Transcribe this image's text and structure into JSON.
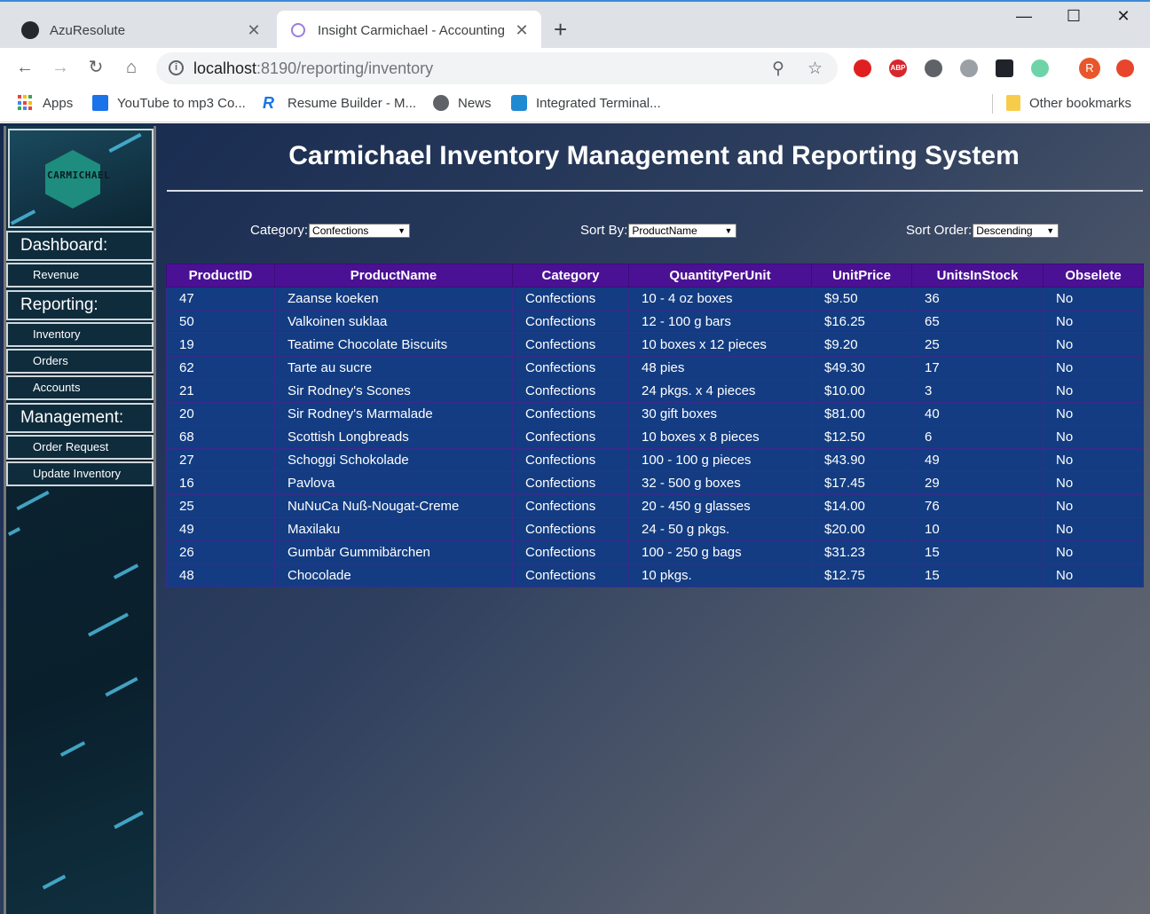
{
  "browser": {
    "tabs": [
      {
        "title": "AzuResolute",
        "icon": "github-icon"
      },
      {
        "title": "Insight Carmichael - Accounting",
        "icon": "app-favicon"
      }
    ],
    "url_host": "localhost",
    "url_path": ":8190/reporting/inventory",
    "bookmarks": [
      {
        "label": "Apps",
        "icon": "apps-icon"
      },
      {
        "label": "YouTube to mp3 Co...",
        "icon": "ytmp3-icon"
      },
      {
        "label": "Resume Builder - M...",
        "icon": "resume-r-icon"
      },
      {
        "label": "News",
        "icon": "globe-icon"
      },
      {
        "label": "Integrated Terminal...",
        "icon": "vscode-icon"
      }
    ],
    "other_bookmarks": "Other bookmarks",
    "profile_initial": "R",
    "extensions": {
      "abp": "ABP"
    }
  },
  "sidebar": {
    "logo_text": "CARMICHAEL",
    "sections": [
      {
        "heading": "Dashboard:",
        "links": [
          "Revenue"
        ]
      },
      {
        "heading": "Reporting:",
        "links": [
          "Inventory",
          "Orders",
          "Accounts"
        ]
      },
      {
        "heading": "Management:",
        "links": [
          "Order Request",
          "Update Inventory"
        ]
      }
    ]
  },
  "page": {
    "title": "Carmichael Inventory Management and Reporting System"
  },
  "filters": {
    "category_label": "Category:",
    "category_value": "Confections",
    "sortby_label": "Sort By:",
    "sortby_value": "ProductName",
    "sortorder_label": "Sort Order:",
    "sortorder_value": "Descending"
  },
  "table": {
    "columns": [
      "ProductID",
      "ProductName",
      "Category",
      "QuantityPerUnit",
      "UnitPrice",
      "UnitsInStock",
      "Obselete"
    ],
    "rows": [
      [
        "47",
        "Zaanse koeken",
        "Confections",
        "10 - 4 oz boxes",
        "$9.50",
        "36",
        "No"
      ],
      [
        "50",
        "Valkoinen suklaa",
        "Confections",
        "12 - 100 g bars",
        "$16.25",
        "65",
        "No"
      ],
      [
        "19",
        "Teatime Chocolate Biscuits",
        "Confections",
        "10 boxes x 12 pieces",
        "$9.20",
        "25",
        "No"
      ],
      [
        "62",
        "Tarte au sucre",
        "Confections",
        "48 pies",
        "$49.30",
        "17",
        "No"
      ],
      [
        "21",
        "Sir Rodney's Scones",
        "Confections",
        "24 pkgs. x 4 pieces",
        "$10.00",
        "3",
        "No"
      ],
      [
        "20",
        "Sir Rodney's Marmalade",
        "Confections",
        "30 gift boxes",
        "$81.00",
        "40",
        "No"
      ],
      [
        "68",
        "Scottish Longbreads",
        "Confections",
        "10 boxes x 8 pieces",
        "$12.50",
        "6",
        "No"
      ],
      [
        "27",
        "Schoggi Schokolade",
        "Confections",
        "100 - 100 g pieces",
        "$43.90",
        "49",
        "No"
      ],
      [
        "16",
        "Pavlova",
        "Confections",
        "32 - 500 g boxes",
        "$17.45",
        "29",
        "No"
      ],
      [
        "25",
        "NuNuCa Nuß-Nougat-Creme",
        "Confections",
        "20 - 450 g glasses",
        "$14.00",
        "76",
        "No"
      ],
      [
        "49",
        "Maxilaku",
        "Confections",
        "24 - 50 g pkgs.",
        "$20.00",
        "10",
        "No"
      ],
      [
        "26",
        "Gumbär Gummibärchen",
        "Confections",
        "100 - 250 g bags",
        "$31.23",
        "15",
        "No"
      ],
      [
        "48",
        "Chocolade",
        "Confections",
        "10 pkgs.",
        "$12.75",
        "15",
        "No"
      ]
    ]
  },
  "colors": {
    "table_header": "#4b1194",
    "table_row": "#133c82",
    "sidebar_bg": "#0b2230"
  }
}
